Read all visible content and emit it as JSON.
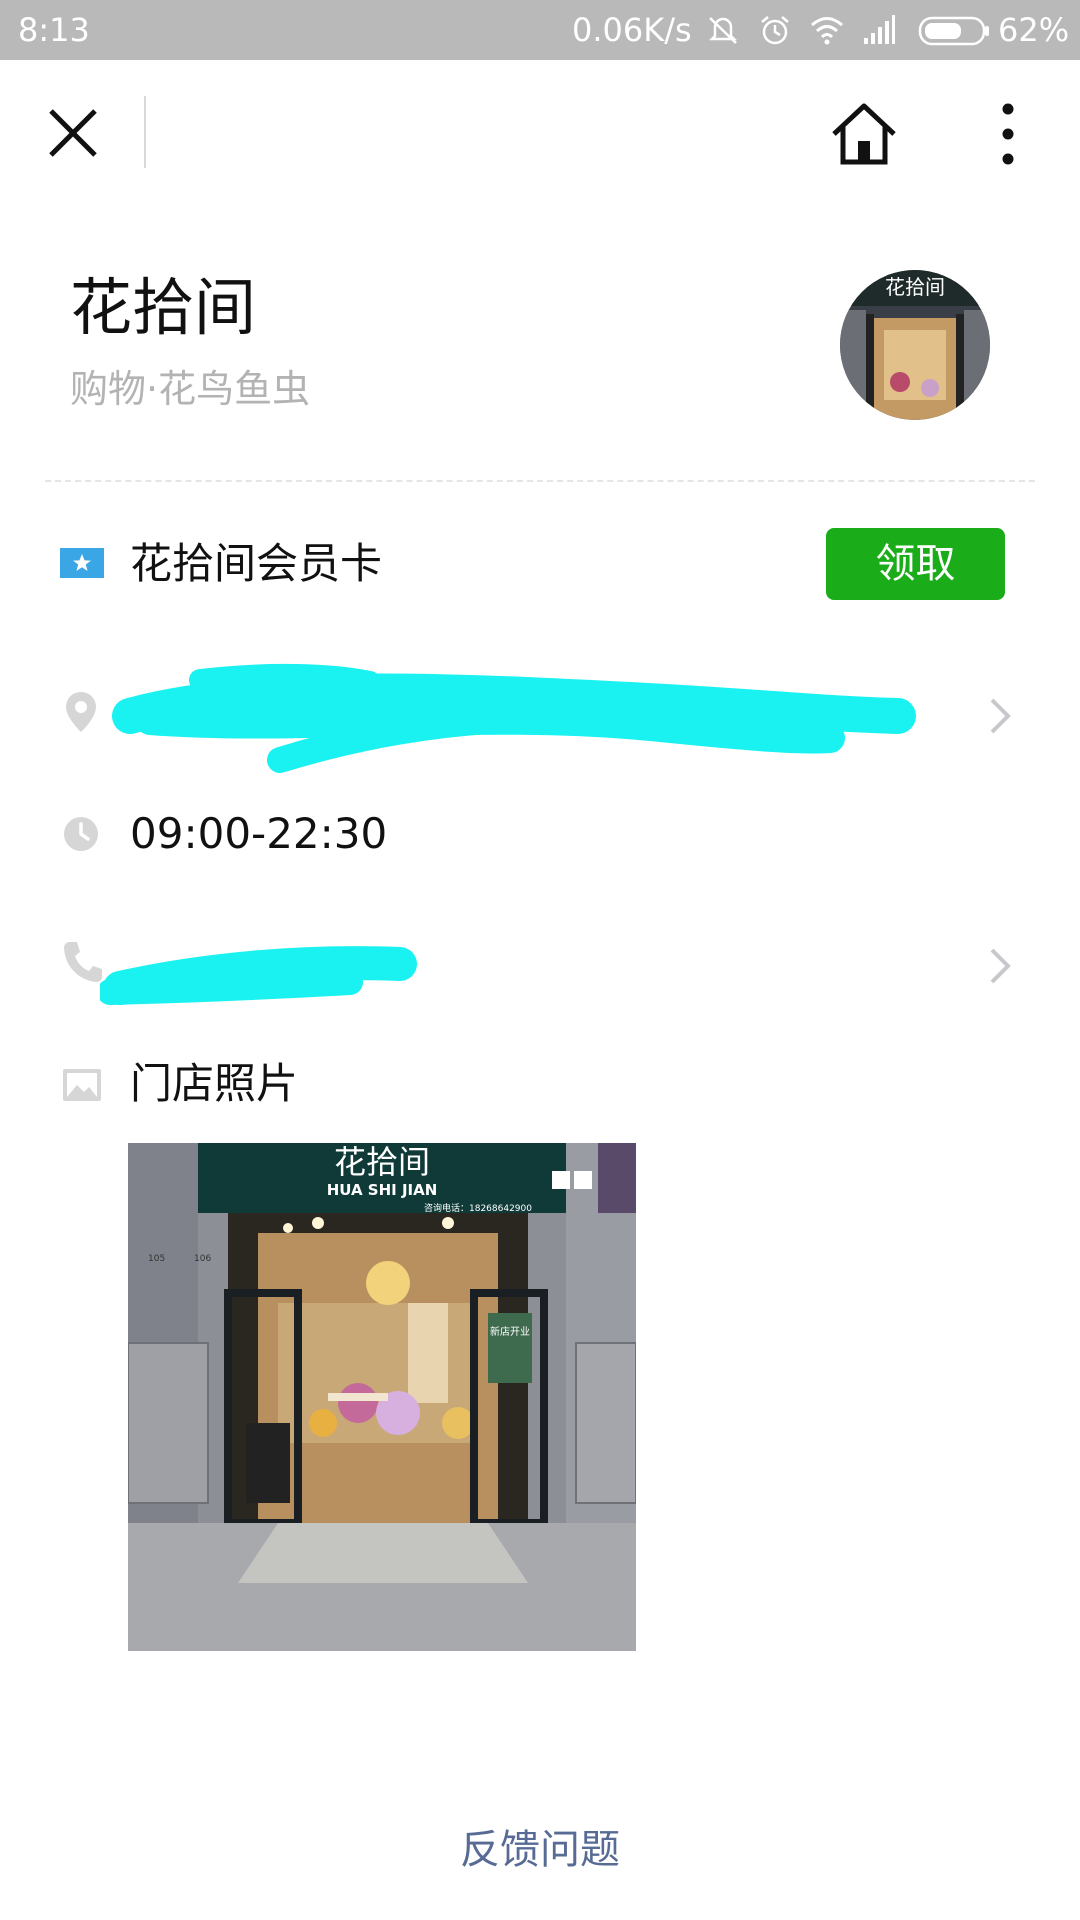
{
  "status_bar": {
    "time": "8:13",
    "network_speed": "0.06K/s",
    "battery": "62%",
    "icons": [
      "mute-icon",
      "alarm-icon",
      "wifi-icon",
      "signal-icon",
      "battery-icon"
    ]
  },
  "nav": {
    "icons": [
      "close-icon",
      "home-icon",
      "more-icon"
    ]
  },
  "store": {
    "name": "花拾间",
    "category": "购物·花鸟鱼虫"
  },
  "member_card": {
    "label": "花拾间会员卡",
    "button_label": "领取",
    "icon": "member-card-icon"
  },
  "info": {
    "address_icon": "location-icon",
    "hours": "09:00-22:30",
    "hours_icon": "clock-icon",
    "phone_icon": "phone-icon"
  },
  "photos": {
    "label": "门店照片",
    "icon": "image-icon",
    "photo_sign_name": "花拾间",
    "photo_sign_pinyin": "HUA SHI JIAN",
    "photo_phone": "咨询电话：18268642900",
    "photo_door_left": "105",
    "photo_door_right": "106",
    "photo_poster": "新店开业"
  },
  "footer": {
    "feedback": "反馈问题"
  },
  "colors": {
    "accent_green": "#1aad19",
    "link_blue": "#576b95",
    "redaction_cyan": "#19f2f0",
    "status_bar_gray": "#b9b9b9"
  }
}
